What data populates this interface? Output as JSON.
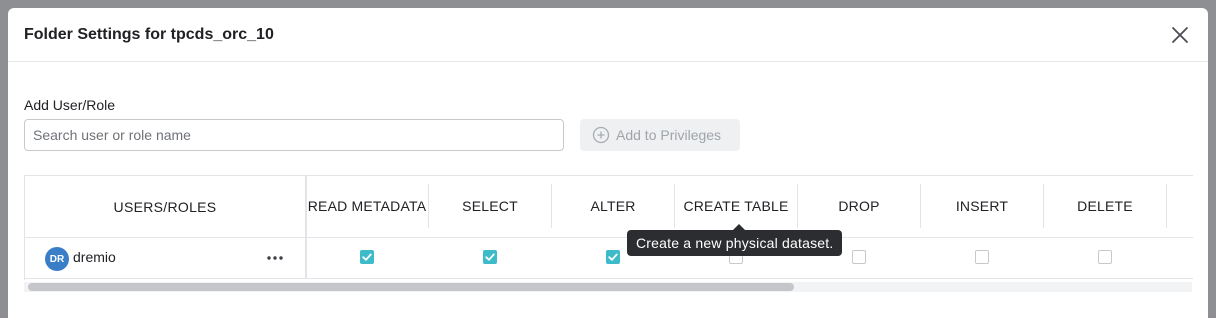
{
  "dialog": {
    "title": "Folder Settings for tpcds_orc_10",
    "close_icon": "close-icon"
  },
  "add_user": {
    "label": "Add User/Role",
    "search_placeholder": "Search user or role name",
    "search_value": "",
    "add_button_label": "Add to Privileges",
    "add_button_icon": "plus-circle-icon"
  },
  "table": {
    "user_column_header": "USERS/ROLES",
    "privilege_headers": [
      "READ METADATA",
      "SELECT",
      "ALTER",
      "CREATE TABLE",
      "DROP",
      "INSERT",
      "DELETE"
    ],
    "rows": [
      {
        "avatar_initials": "DR",
        "name": "dremio",
        "menu_icon": "more-horizontal-icon",
        "privileges": [
          true,
          true,
          true,
          false,
          false,
          false,
          false
        ]
      }
    ]
  },
  "tooltip": {
    "text": "Create a new physical dataset."
  },
  "colors": {
    "checkbox_checked": "#3dbbc8",
    "avatar": "#3a7ec8",
    "tooltip_bg": "#2b2d31"
  }
}
